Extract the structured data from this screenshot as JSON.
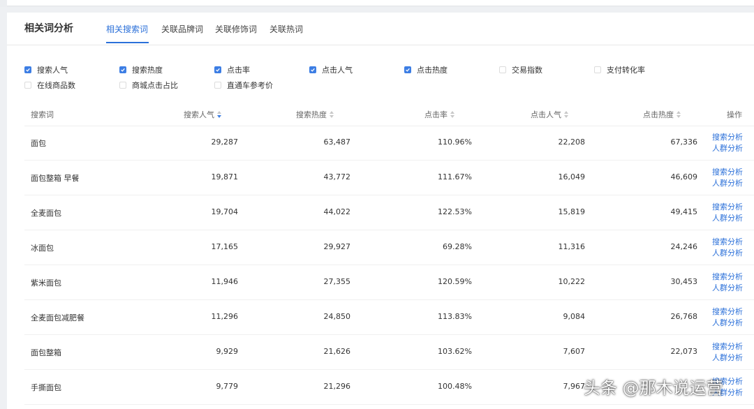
{
  "header": {
    "title": "相关词分析",
    "tabs": [
      {
        "label": "相关搜索词",
        "active": true
      },
      {
        "label": "关联品牌词",
        "active": false
      },
      {
        "label": "关联修饰词",
        "active": false
      },
      {
        "label": "关联热词",
        "active": false
      }
    ]
  },
  "filters": [
    {
      "label": "搜索人气",
      "checked": true
    },
    {
      "label": "搜索热度",
      "checked": true
    },
    {
      "label": "点击率",
      "checked": true
    },
    {
      "label": "点击人气",
      "checked": true
    },
    {
      "label": "点击热度",
      "checked": true
    },
    {
      "label": "交易指数",
      "checked": false
    },
    {
      "label": "支付转化率",
      "checked": false
    },
    {
      "label": "在线商品数",
      "checked": false
    },
    {
      "label": "商城点击占比",
      "checked": false
    },
    {
      "label": "直通车参考价",
      "checked": false
    }
  ],
  "table": {
    "columns": [
      "搜索词",
      "搜索人气",
      "搜索热度",
      "点击率",
      "点击人气",
      "点击热度",
      "操作"
    ],
    "rows": [
      {
        "term": "面包",
        "search_popularity": "29,287",
        "search_heat": "63,487",
        "ctr": "110.96%",
        "click_popularity": "22,208",
        "click_heat": "67,336"
      },
      {
        "term": "面包整箱 早餐",
        "search_popularity": "19,871",
        "search_heat": "43,772",
        "ctr": "111.67%",
        "click_popularity": "16,049",
        "click_heat": "46,609"
      },
      {
        "term": "全麦面包",
        "search_popularity": "19,704",
        "search_heat": "44,022",
        "ctr": "122.53%",
        "click_popularity": "15,819",
        "click_heat": "49,415"
      },
      {
        "term": "冰面包",
        "search_popularity": "17,165",
        "search_heat": "29,927",
        "ctr": "69.28%",
        "click_popularity": "11,316",
        "click_heat": "24,246"
      },
      {
        "term": "紫米面包",
        "search_popularity": "11,946",
        "search_heat": "27,355",
        "ctr": "120.59%",
        "click_popularity": "10,222",
        "click_heat": "30,453"
      },
      {
        "term": "全麦面包减肥餐",
        "search_popularity": "11,296",
        "search_heat": "24,850",
        "ctr": "113.83%",
        "click_popularity": "9,084",
        "click_heat": "26,768"
      },
      {
        "term": "面包整箱",
        "search_popularity": "9,929",
        "search_heat": "21,626",
        "ctr": "103.62%",
        "click_popularity": "7,607",
        "click_heat": "22,073"
      },
      {
        "term": "手撕面包",
        "search_popularity": "9,779",
        "search_heat": "21,296",
        "ctr": "100.48%",
        "click_popularity": "7,967",
        "click_heat": ""
      }
    ],
    "actions": {
      "search_analysis": "搜索分析",
      "crowd_analysis": "人群分析"
    }
  },
  "watermark": "头条 @那木说运营",
  "colors": {
    "accent": "#2b70d9",
    "checkbox": "#3d7ee4"
  }
}
